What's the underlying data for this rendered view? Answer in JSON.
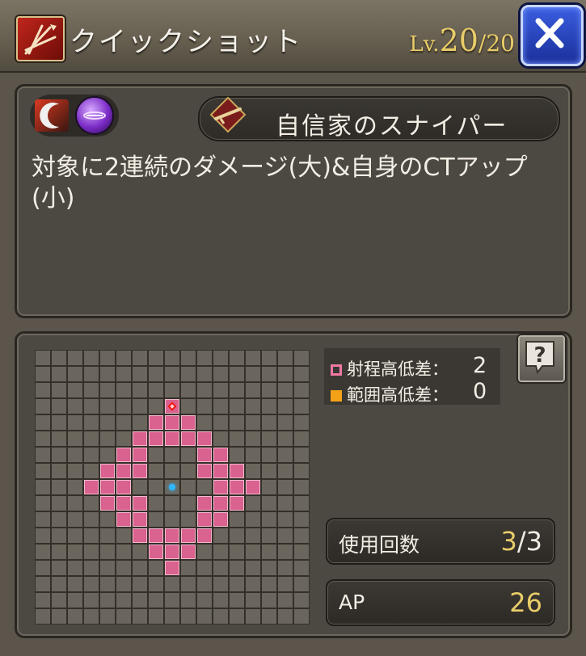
{
  "header": {
    "title": "クイックショット",
    "level_label": "Lv.",
    "level_current": "20",
    "level_separator": "/",
    "level_max": "20"
  },
  "skill": {
    "type_label": "自信家のスナイパー",
    "description": "対象に2連続のダメージ(大)&自身のCTアップ(小)"
  },
  "area": {
    "grid_size": 17,
    "center": [
      8,
      8
    ],
    "target": [
      8,
      3
    ],
    "range_cells": [
      [
        8,
        3
      ],
      [
        7,
        4
      ],
      [
        8,
        4
      ],
      [
        9,
        4
      ],
      [
        6,
        5
      ],
      [
        7,
        5
      ],
      [
        8,
        5
      ],
      [
        9,
        5
      ],
      [
        10,
        5
      ],
      [
        5,
        6
      ],
      [
        6,
        6
      ],
      [
        10,
        6
      ],
      [
        11,
        6
      ],
      [
        4,
        7
      ],
      [
        5,
        7
      ],
      [
        6,
        7
      ],
      [
        10,
        7
      ],
      [
        11,
        7
      ],
      [
        12,
        7
      ],
      [
        3,
        8
      ],
      [
        4,
        8
      ],
      [
        5,
        8
      ],
      [
        11,
        8
      ],
      [
        12,
        8
      ],
      [
        13,
        8
      ],
      [
        4,
        9
      ],
      [
        5,
        9
      ],
      [
        6,
        9
      ],
      [
        10,
        9
      ],
      [
        11,
        9
      ],
      [
        12,
        9
      ],
      [
        5,
        10
      ],
      [
        6,
        10
      ],
      [
        10,
        10
      ],
      [
        11,
        10
      ],
      [
        6,
        11
      ],
      [
        7,
        11
      ],
      [
        8,
        11
      ],
      [
        9,
        11
      ],
      [
        10,
        11
      ],
      [
        7,
        12
      ],
      [
        8,
        12
      ],
      [
        9,
        12
      ],
      [
        8,
        13
      ]
    ],
    "range_height_label": "射程高低差：",
    "range_height_value": "2",
    "area_height_label": "範囲高低差：",
    "area_height_value": "0"
  },
  "stats": {
    "uses_label": "使用回数",
    "uses_current": "3",
    "uses_separator": "/",
    "uses_max": "3",
    "ap_label": "AP",
    "ap_value": "26"
  },
  "colors": {
    "range_cell": "#d9628f",
    "area_marker": "#f3a218",
    "accent_gold": "#e9cd69",
    "close_button": "#2e49c8"
  },
  "icons": {
    "skill": "arrow-burst-icon",
    "close": "close-icon",
    "buff": "crescent-slash-icon",
    "element": "purple-orb-icon",
    "type": "rifle-book-icon",
    "help": "question-mark-icon"
  }
}
